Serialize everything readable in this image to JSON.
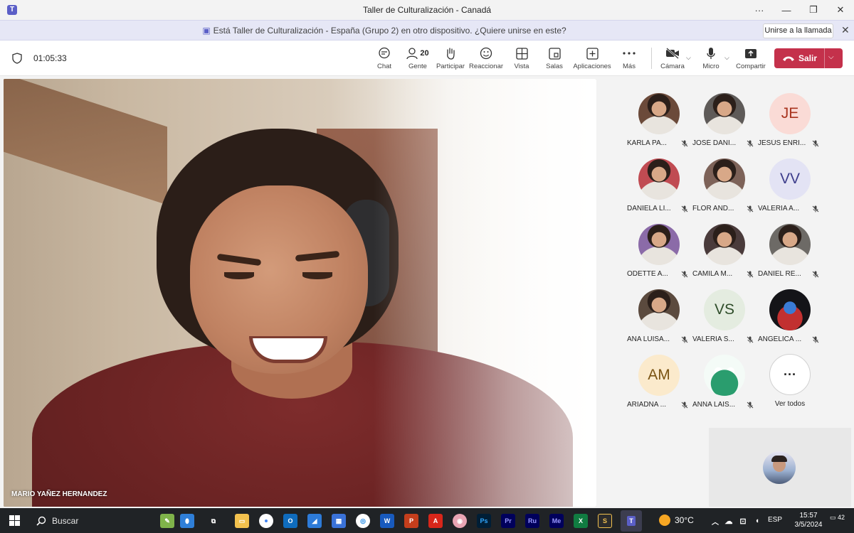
{
  "window": {
    "title": "Taller de Culturalización - Canadá",
    "controls": [
      "···",
      "—",
      "❐",
      "✕"
    ]
  },
  "notice": {
    "text": "Está Taller de Culturalización - España (Grupo 2) en otro dispositivo. ¿Quiere unirse en este?",
    "join_label": "Unirse a la llamada",
    "close": "✕"
  },
  "toolbar": {
    "timer": "01:05:33",
    "chat": "Chat",
    "people": "Gente",
    "people_count": "20",
    "raise": "Participar",
    "react": "Reaccionar",
    "view": "Vista",
    "rooms": "Salas",
    "apps": "Aplicaciones",
    "more": "Más",
    "camera": "Cámara",
    "mic": "Micro",
    "share": "Compartir",
    "leave": "Salir"
  },
  "main_video": {
    "name": "MARIO YAÑEZ HERNANDEZ"
  },
  "participants": [
    {
      "name": "KARLA PA...",
      "initials": "",
      "bg": "#6b4a3a",
      "fg": "#ffffff"
    },
    {
      "name": "JOSÉ DANI...",
      "initials": "",
      "bg": "#5e5a58",
      "fg": "#ffffff"
    },
    {
      "name": "JESÚS ENRI...",
      "initials": "JE",
      "bg": "#fadbd6",
      "fg": "#a8341f"
    },
    {
      "name": "DANIELA LI...",
      "initials": "",
      "bg": "#c04b52",
      "fg": "#ffffff"
    },
    {
      "name": "FLOR AND...",
      "initials": "",
      "bg": "#7d6258",
      "fg": "#ffffff"
    },
    {
      "name": "VALERIA A...",
      "initials": "VV",
      "bg": "#e3e3f4",
      "fg": "#3d3d8c"
    },
    {
      "name": "ODETTE A...",
      "initials": "",
      "bg": "#8b6ba8",
      "fg": "#ffffff"
    },
    {
      "name": "CAMILA M...",
      "initials": "",
      "bg": "#4a3b3b",
      "fg": "#ffffff"
    },
    {
      "name": "DANIEL RE...",
      "initials": "",
      "bg": "#6d6a66",
      "fg": "#ffffff"
    },
    {
      "name": "ANA LUISA...",
      "initials": "",
      "bg": "#5b4a3e",
      "fg": "#ffffff"
    },
    {
      "name": "VALERIA S...",
      "initials": "VS",
      "bg": "#e4ece0",
      "fg": "#2f4d2a"
    },
    {
      "name": "ANGELICA ...",
      "initials": "",
      "bg": "#1c1c22",
      "fg": "#ffffff"
    },
    {
      "name": "ARIADNA ...",
      "initials": "AM",
      "bg": "#fbeacc",
      "fg": "#7a5312"
    },
    {
      "name": "ANNA LAIS...",
      "initials": "",
      "bg": "#ffffff",
      "fg": "#ffffff"
    }
  ],
  "see_all": {
    "label": "Ver todos",
    "glyph": "···"
  },
  "taskbar": {
    "search": "Buscar",
    "apps": [
      "Ps",
      "Pr",
      "Ru",
      "Me"
    ],
    "temperature": "30°C",
    "lang": "ESP",
    "time": "15:57",
    "date": "3/5/2024",
    "notifications": "42"
  },
  "colors": {
    "accent": "#5b5fc7",
    "leave": "#c4314b"
  }
}
